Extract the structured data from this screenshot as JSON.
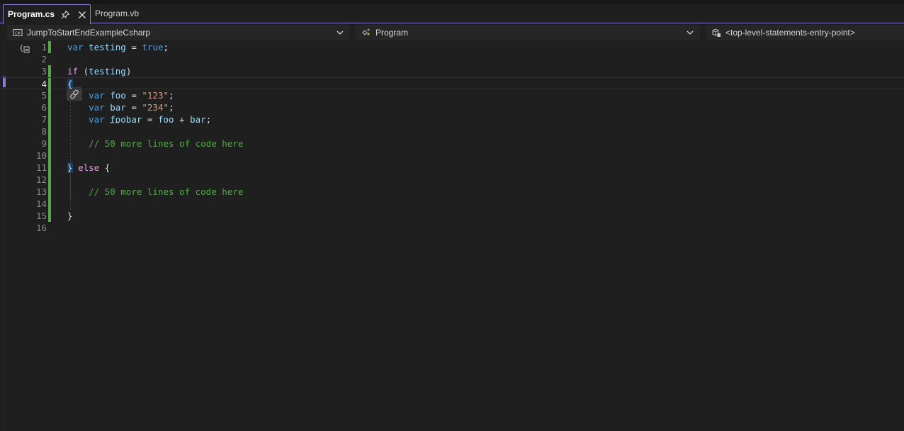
{
  "tabs": [
    {
      "label": "Program.cs",
      "active": true,
      "pinned": true
    },
    {
      "label": "Program.vb",
      "active": false
    }
  ],
  "navbar": {
    "project": {
      "label": "JumpToStartEndExampleCsharp",
      "icon": "csharp-project-icon"
    },
    "type": {
      "label": "Program",
      "icon": "class-icon"
    },
    "member": {
      "label": "<top-level-statements-entry-point>",
      "icon": "method-icon"
    }
  },
  "editor": {
    "current_line": 4,
    "line_numbers": [
      "1",
      "2",
      "3",
      "4",
      "5",
      "6",
      "7",
      "8",
      "9",
      "10",
      "11",
      "12",
      "13",
      "14",
      "15",
      "16"
    ],
    "lines": [
      [
        {
          "t": "var",
          "c": "kw"
        },
        {
          "t": " "
        },
        {
          "t": "testing",
          "c": "var"
        },
        {
          "t": " = "
        },
        {
          "t": "true",
          "c": "kw"
        },
        {
          "t": ";"
        }
      ],
      [],
      [
        {
          "t": "if",
          "c": "ctl"
        },
        {
          "t": " ("
        },
        {
          "t": "testing",
          "c": "var"
        },
        {
          "t": ")"
        }
      ],
      [
        {
          "t": "{",
          "c": "brace"
        }
      ],
      [
        {
          "t": "    "
        },
        {
          "t": "var",
          "c": "kw"
        },
        {
          "t": " "
        },
        {
          "t": "foo",
          "c": "var"
        },
        {
          "t": " = "
        },
        {
          "t": "\"123\"",
          "c": "str"
        },
        {
          "t": ";"
        }
      ],
      [
        {
          "t": "    "
        },
        {
          "t": "var",
          "c": "kw"
        },
        {
          "t": " "
        },
        {
          "t": "bar",
          "c": "var"
        },
        {
          "t": " = "
        },
        {
          "t": "\"234\"",
          "c": "str"
        },
        {
          "t": ";"
        }
      ],
      [
        {
          "t": "    "
        },
        {
          "t": "var",
          "c": "kw"
        },
        {
          "t": " "
        },
        {
          "t": "foobar",
          "c": "var"
        },
        {
          "t": " = "
        },
        {
          "t": "foo",
          "c": "var"
        },
        {
          "t": " + "
        },
        {
          "t": "bar",
          "c": "var"
        },
        {
          "t": ";"
        }
      ],
      [],
      [
        {
          "t": "    "
        },
        {
          "t": "// 50 more lines of code here",
          "c": "cmt"
        }
      ],
      [],
      [
        {
          "t": "}",
          "c": "brace"
        },
        {
          "t": " "
        },
        {
          "t": "else",
          "c": "ctl"
        },
        {
          "t": " {"
        }
      ],
      [],
      [
        {
          "t": "    "
        },
        {
          "t": "// 50 more lines of code here",
          "c": "cmt"
        }
      ],
      [],
      [
        {
          "t": "}"
        }
      ],
      []
    ]
  },
  "colors": {
    "accent": "#8a7bd6",
    "change_bar": "#57a64a",
    "keyword": "#569cd6",
    "control": "#d8a0df",
    "identifier": "#9cdcfe",
    "string": "#d69d85",
    "comment": "#57a64a"
  }
}
